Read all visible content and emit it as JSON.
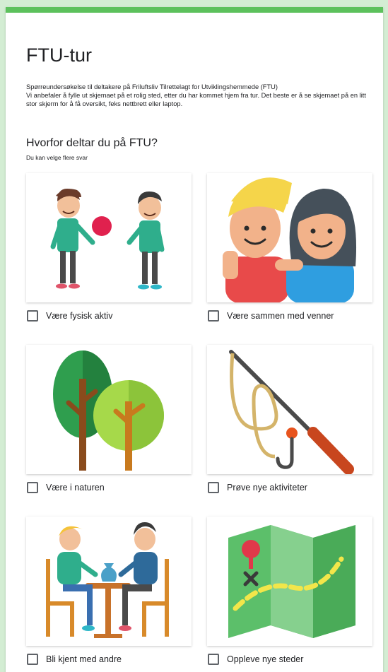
{
  "form": {
    "title": "FTU-tur",
    "description_lines": [
      "Spørreundersøkelse til deltakere på Friluftsliv Tilrettelagt for Utviklingshemmede (FTU)",
      "Vi anbefaler å fylle ut skjemaet på et rolig sted, etter du har kommet hjem fra tur. Det beste er å se skjemaet på en litt stor skjerm for å få oversikt, feks nettbrett eller laptop."
    ]
  },
  "question": {
    "title": "Hvorfor deltar du på FTU?",
    "hint": "Du kan velge flere svar",
    "options": [
      {
        "label": "Være fysisk aktiv",
        "icon": "playing-ball-illustration",
        "checked": false
      },
      {
        "label": "Være sammen med venner",
        "icon": "two-friends-illustration",
        "checked": false
      },
      {
        "label": "Være i naturen",
        "icon": "trees-illustration",
        "checked": false
      },
      {
        "label": "Prøve nye aktiviteter",
        "icon": "fishing-rod-illustration",
        "checked": false
      },
      {
        "label": "Bli kjent med andre",
        "icon": "people-at-table-illustration",
        "checked": false
      },
      {
        "label": "Oppleve nye steder",
        "icon": "map-illustration",
        "checked": false
      }
    ]
  },
  "colors": {
    "accent": "#5cc15c",
    "background": "#d3edd3"
  }
}
